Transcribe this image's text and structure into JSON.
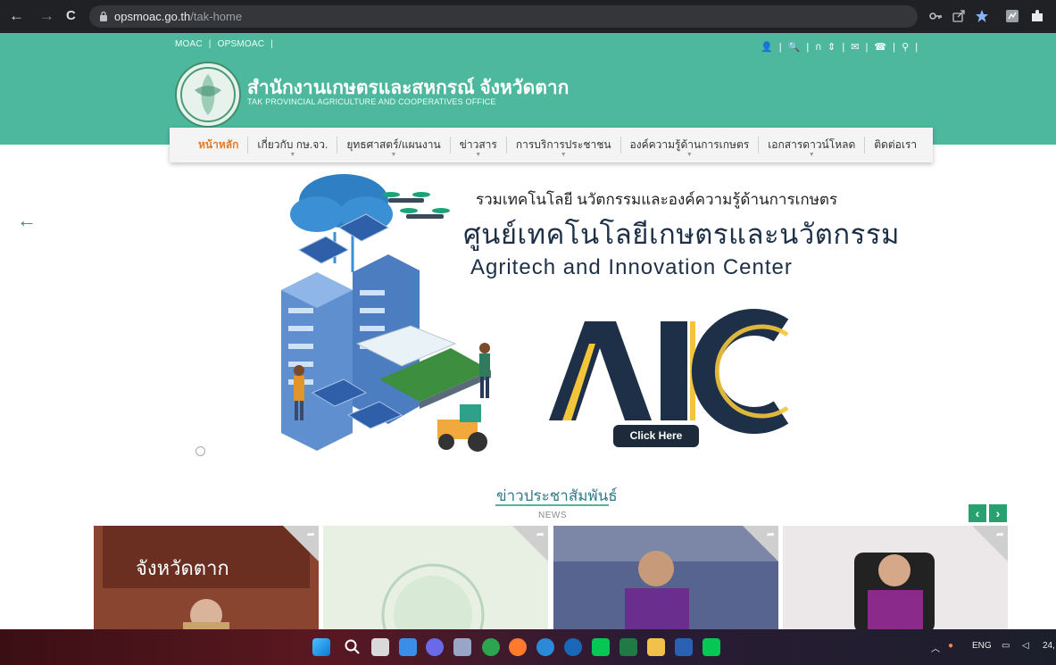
{
  "browser": {
    "url_host": "opsmoac.go.th",
    "url_path": "/tak-home",
    "back_glyph": "←",
    "forward_glyph": "→",
    "reload_glyph": "C",
    "icons": [
      "key-icon",
      "share-icon",
      "bookmark-star-icon",
      "extension-icon",
      "puzzle-icon"
    ]
  },
  "header": {
    "top_links": [
      "MOAC",
      "|",
      "OPSMOAC",
      "|"
    ],
    "top_icons_text": "👤 | 🔍 | ก ⇕ | ✉ | ☎ | ⚲ |",
    "site_name_th": "สำนักงานเกษตรและสหกรณ์ จังหวัดตาก",
    "site_name_en": "TAK PROVINCIAL AGRICULTURE AND COOPERATIVES OFFICE"
  },
  "menu": {
    "items": [
      {
        "label": "หน้าหลัก",
        "active": true,
        "dropdown": false
      },
      {
        "label": "เกี่ยวกับ กษ.จว.",
        "active": false,
        "dropdown": true
      },
      {
        "label": "ยุทธศาสตร์/แผนงาน",
        "active": false,
        "dropdown": true
      },
      {
        "label": "ข่าวสาร",
        "active": false,
        "dropdown": true
      },
      {
        "label": "การบริการประชาชน",
        "active": false,
        "dropdown": true
      },
      {
        "label": "องค์ความรู้ด้านการเกษตร",
        "active": false,
        "dropdown": true
      },
      {
        "label": "เอกสารดาวน์โหลด",
        "active": false,
        "dropdown": true
      },
      {
        "label": "ติดต่อเรา",
        "active": false,
        "dropdown": false
      }
    ]
  },
  "banner": {
    "prev_glyph": "←",
    "line1": "รวมเทคโนโลยี นวัตกรรมและองค์ความรู้ด้านการเกษตร",
    "line2": "ศูนย์เทคโนโลยีเกษตรและนวัตกรรม",
    "line3": "Agritech and Innovation Center",
    "logo_text": "AIC",
    "cta_label": "Click Here"
  },
  "news": {
    "title": "ข่าวประชาสัมพันธ์",
    "subtitle": "NEWS",
    "prev_glyph": "‹",
    "next_glyph": "›",
    "card1_sign": "จังหวัดตาก"
  },
  "taskbar": {
    "lang": "ENG",
    "clock_fragment": "24,"
  },
  "colors": {
    "header_green": "#4db89d",
    "menu_active": "#e07b2a",
    "aic_navy": "#1d3047",
    "aic_yellow": "#f3c53a",
    "news_button": "#28a06f"
  }
}
